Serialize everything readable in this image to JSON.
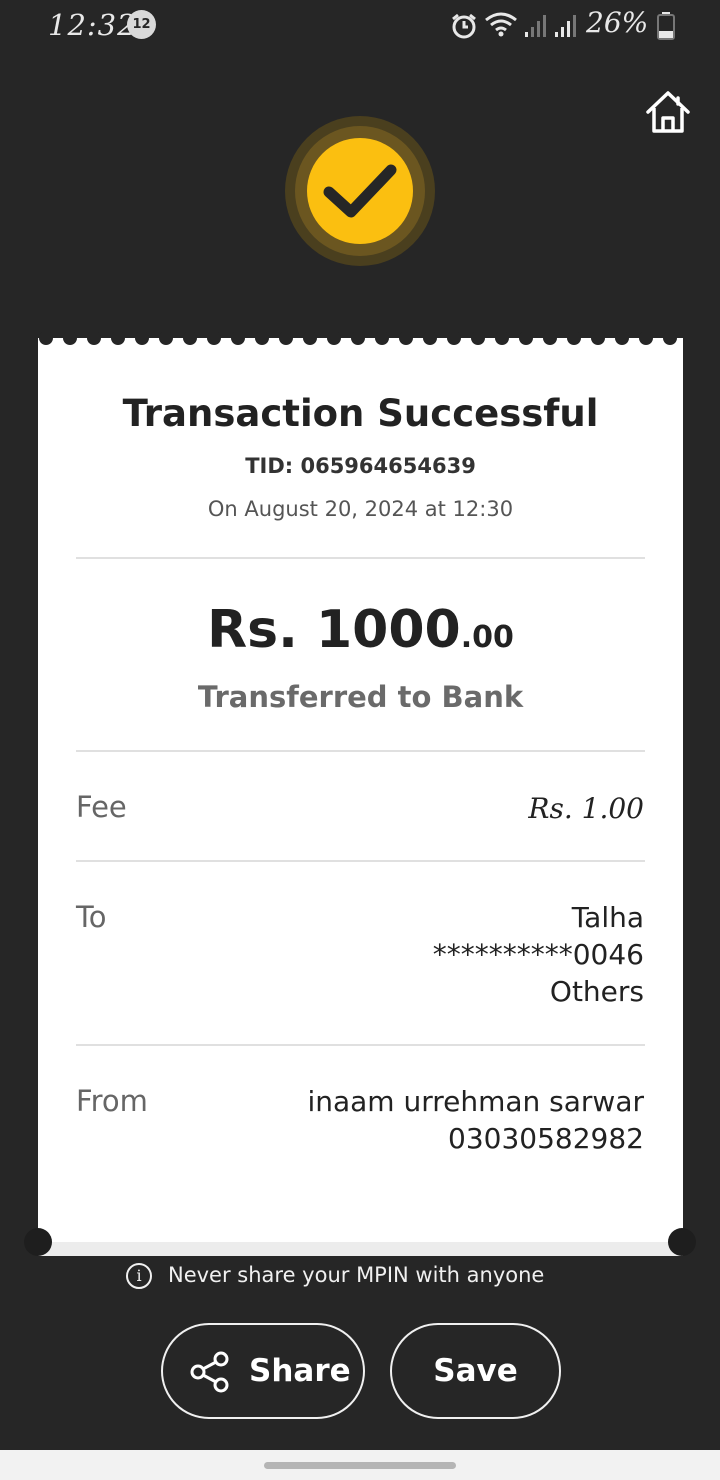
{
  "status_bar": {
    "time": "12:32",
    "notification_count": "12",
    "battery_percent": "26%",
    "icons": [
      "alarm-icon",
      "wifi-icon",
      "signal-icon",
      "signal-icon",
      "battery-icon"
    ]
  },
  "header": {
    "home_icon": "home-icon",
    "status_icon": "check-icon"
  },
  "receipt": {
    "title": "Transaction Successful",
    "tid": "TID: 065964654639",
    "datetime": "On August 20, 2024 at 12:30",
    "amount_main": "Rs. 1000",
    "amount_cents": ".00",
    "amount_label": "Transferred to Bank",
    "fee": {
      "label": "Fee",
      "value": "Rs. 1.00"
    },
    "to": {
      "label": "To",
      "name": "Talha",
      "account": "**********0046",
      "bank": "Others"
    },
    "from": {
      "label": "From",
      "name": "inaam urrehman sarwar",
      "account": "03030582982"
    }
  },
  "notice": {
    "icon": "info-icon",
    "text": "Never share your MPIN with anyone"
  },
  "actions": {
    "share_label": "Share",
    "save_label": "Save"
  },
  "colors": {
    "accent": "#fbbf10",
    "background": "#262626",
    "card": "#ffffff"
  }
}
